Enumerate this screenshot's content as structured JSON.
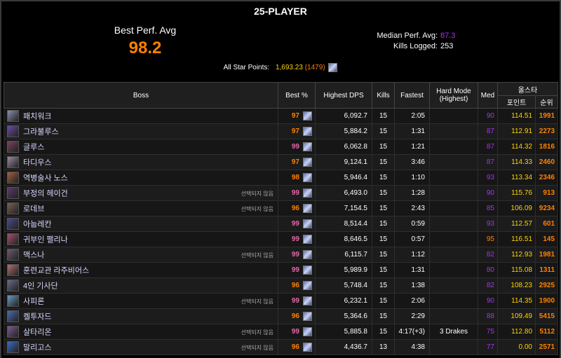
{
  "header": {
    "title": "25-PLAYER",
    "best_label": "Best Perf. Avg",
    "best_value": "98.2",
    "median_label": "Median Perf. Avg:",
    "median_value": "87.3",
    "kills_label": "Kills Logged:",
    "kills_value": "253",
    "allstar_label": "All Star Points:",
    "allstar_points": "1,693.23",
    "allstar_rank_open": "(",
    "allstar_rank": "1479",
    "allstar_rank_close": ")"
  },
  "columns": {
    "boss": "Boss",
    "best": "Best %",
    "dps": "Highest DPS",
    "kills": "Kills",
    "fastest": "Fastest",
    "hardmode_1": "Hard Mode",
    "hardmode_2": "(Highest)",
    "med": "Med",
    "allstar": "올스타",
    "points": "포인트",
    "rank": "순위"
  },
  "colors": {
    "legendary": "#ff8000",
    "epic": "#a335ee",
    "astounding": "#e268a8",
    "points": "#ffd400"
  },
  "rows": [
    {
      "icon": "patchwerk-portrait-icon",
      "name": "패치워크",
      "unselected": "",
      "best": "97",
      "best_color": "orange",
      "dps": "6,092.7",
      "kills": "15",
      "fastest": "2:05",
      "hardmode": "",
      "med": "90",
      "med_color": "purple",
      "points": "114.51",
      "rank": "1991"
    },
    {
      "icon": "grobbulus-portrait-icon",
      "name": "그라불루스",
      "unselected": "",
      "best": "97",
      "best_color": "orange",
      "dps": "5,884.2",
      "kills": "15",
      "fastest": "1:31",
      "hardmode": "",
      "med": "87",
      "med_color": "purple",
      "points": "112.91",
      "rank": "2273"
    },
    {
      "icon": "gluth-portrait-icon",
      "name": "글루스",
      "unselected": "",
      "best": "99",
      "best_color": "pink",
      "dps": "6,062.8",
      "kills": "15",
      "fastest": "1:21",
      "hardmode": "",
      "med": "87",
      "med_color": "purple",
      "points": "114.32",
      "rank": "1816"
    },
    {
      "icon": "thaddius-portrait-icon",
      "name": "타디우스",
      "unselected": "",
      "best": "97",
      "best_color": "orange",
      "dps": "9,124.1",
      "kills": "15",
      "fastest": "3:46",
      "hardmode": "",
      "med": "87",
      "med_color": "purple",
      "points": "114.33",
      "rank": "2460"
    },
    {
      "icon": "noth-portrait-icon",
      "name": "역병술사 노스",
      "unselected": "",
      "best": "98",
      "best_color": "orange",
      "dps": "5,946.4",
      "kills": "15",
      "fastest": "1:10",
      "hardmode": "",
      "med": "93",
      "med_color": "purple",
      "points": "113.34",
      "rank": "2346"
    },
    {
      "icon": "heigan-portrait-icon",
      "name": "부정의 헤이건",
      "unselected": "선택되지 않음",
      "best": "99",
      "best_color": "pink",
      "dps": "6,493.0",
      "kills": "15",
      "fastest": "1:28",
      "hardmode": "",
      "med": "90",
      "med_color": "purple",
      "points": "115.76",
      "rank": "913"
    },
    {
      "icon": "loatheb-portrait-icon",
      "name": "로데브",
      "unselected": "선택되지 않음",
      "best": "96",
      "best_color": "orange",
      "dps": "7,154.5",
      "kills": "15",
      "fastest": "2:43",
      "hardmode": "",
      "med": "85",
      "med_color": "purple",
      "points": "106.09",
      "rank": "9234"
    },
    {
      "icon": "anubrekhan-portrait-icon",
      "name": "아눕레칸",
      "unselected": "",
      "best": "99",
      "best_color": "pink",
      "dps": "8,514.4",
      "kills": "15",
      "fastest": "0:59",
      "hardmode": "",
      "med": "93",
      "med_color": "purple",
      "points": "112.57",
      "rank": "601"
    },
    {
      "icon": "faerlina-portrait-icon",
      "name": "귀부인 팰리나",
      "unselected": "",
      "best": "99",
      "best_color": "pink",
      "dps": "8,646.5",
      "kills": "15",
      "fastest": "0:57",
      "hardmode": "",
      "med": "95",
      "med_color": "orange",
      "points": "116.51",
      "rank": "145"
    },
    {
      "icon": "maexxna-portrait-icon",
      "name": "맥스나",
      "unselected": "선택되지 않음",
      "best": "99",
      "best_color": "pink",
      "dps": "6,115.7",
      "kills": "15",
      "fastest": "1:12",
      "hardmode": "",
      "med": "82",
      "med_color": "purple",
      "points": "112.93",
      "rank": "1981"
    },
    {
      "icon": "razuvious-portrait-icon",
      "name": "훈련교관 라주비어스",
      "unselected": "",
      "best": "99",
      "best_color": "pink",
      "dps": "5,989.9",
      "kills": "15",
      "fastest": "1:31",
      "hardmode": "",
      "med": "80",
      "med_color": "purple",
      "points": "115.08",
      "rank": "1311"
    },
    {
      "icon": "four-horsemen-portrait-icon",
      "name": "4인 기사단",
      "unselected": "",
      "best": "96",
      "best_color": "orange",
      "dps": "5,748.4",
      "kills": "15",
      "fastest": "1:38",
      "hardmode": "",
      "med": "82",
      "med_color": "purple",
      "points": "108.23",
      "rank": "2925"
    },
    {
      "icon": "sapphiron-portrait-icon",
      "name": "사피론",
      "unselected": "선택되지 않음",
      "best": "99",
      "best_color": "pink",
      "dps": "6,232.1",
      "kills": "15",
      "fastest": "2:06",
      "hardmode": "",
      "med": "90",
      "med_color": "purple",
      "points": "114.35",
      "rank": "1900"
    },
    {
      "icon": "kelthuzad-portrait-icon",
      "name": "켈투자드",
      "unselected": "",
      "best": "96",
      "best_color": "orange",
      "dps": "5,364.6",
      "kills": "15",
      "fastest": "2:29",
      "hardmode": "",
      "med": "88",
      "med_color": "purple",
      "points": "109.49",
      "rank": "5415"
    },
    {
      "icon": "sartharion-portrait-icon",
      "name": "살타리온",
      "unselected": "선택되지 않음",
      "best": "99",
      "best_color": "pink",
      "dps": "5,885.8",
      "kills": "15",
      "fastest": "4:17(+3)",
      "hardmode": "3 Drakes",
      "med": "75",
      "med_color": "purple",
      "points": "112.80",
      "rank": "5112"
    },
    {
      "icon": "malygos-portrait-icon",
      "name": "말리고스",
      "unselected": "선택되지 않음",
      "best": "96",
      "best_color": "orange",
      "dps": "4,436.7",
      "kills": "13",
      "fastest": "4:38",
      "hardmode": "",
      "med": "77",
      "med_color": "purple",
      "points": "0.00",
      "rank": "2571"
    }
  ]
}
